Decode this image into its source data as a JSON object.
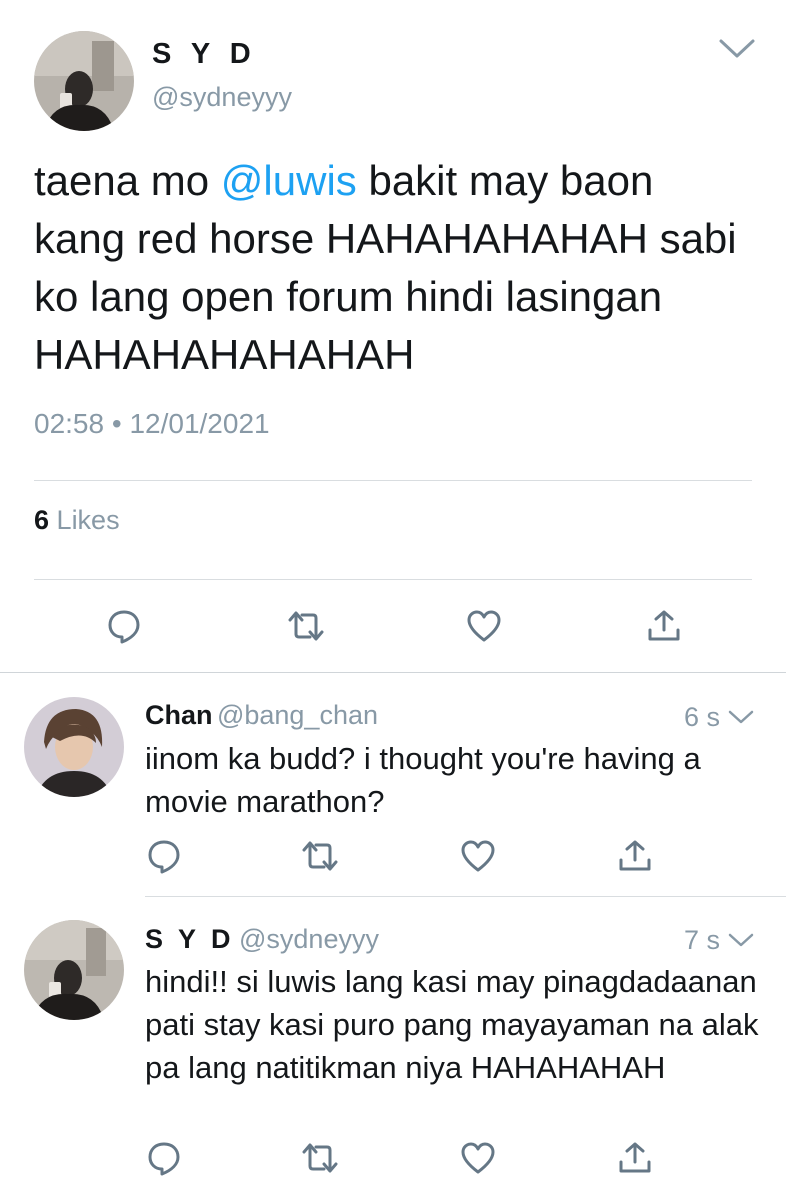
{
  "main_tweet": {
    "name": "S Y D",
    "handle": "@sydneyyy",
    "text_before": "taena mo ",
    "mention": "@luwis",
    "text_after": " bakit may baon kang red horse HAHAHAHAHAH sabi ko lang open forum hindi lasingan HAHAHAHAHAHAH",
    "time": "02:58",
    "separator": "•",
    "date": "12/01/2021",
    "likes_count": "6",
    "likes_label": "Likes"
  },
  "replies": [
    {
      "name": "Chan",
      "handle": "@bang_chan",
      "time": "6 s",
      "text": "iinom ka budd? i thought you're having a movie marathon?"
    },
    {
      "name": "S Y D",
      "handle": "@sydneyyy",
      "time": "7 s",
      "text": "hindi!! si luwis lang kasi may pinagdadaanan pati stay kasi puro pang mayayaman na alak pa lang natitikman niya HAHAHAHAH"
    }
  ],
  "icons": {
    "reply": "reply-icon",
    "retweet": "retweet-icon",
    "like": "heart-icon",
    "share": "share-icon",
    "more": "chevron-down-icon"
  },
  "colors": {
    "mention": "#1da1f2",
    "secondary_text": "#8899a6",
    "icon": "#657786"
  }
}
